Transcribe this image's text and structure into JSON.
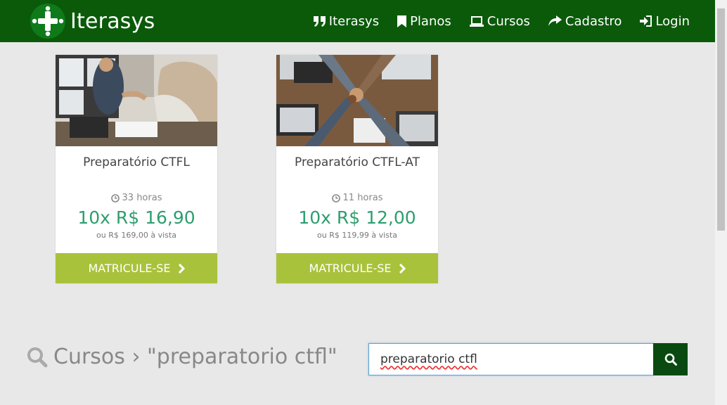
{
  "brand": {
    "name": "Iterasys"
  },
  "nav": [
    {
      "label": "Iterasys",
      "icon": "quote-icon"
    },
    {
      "label": "Planos",
      "icon": "bookmark-icon"
    },
    {
      "label": "Cursos",
      "icon": "laptop-icon"
    },
    {
      "label": "Cadastro",
      "icon": "share-icon"
    },
    {
      "label": "Login",
      "icon": "sign-in-icon"
    }
  ],
  "cards": [
    {
      "title": "Preparatório CTFL",
      "hours": "33 horas",
      "price": "10x R$ 16,90",
      "cash": "ou R$ 169,00 à vista",
      "button": "MATRICULE-SE"
    },
    {
      "title": "Preparatório CTFL-AT",
      "hours": "11 horas",
      "price": "10x R$ 12,00",
      "cash": "ou R$ 119,99 à vista",
      "button": "MATRICULE-SE"
    }
  ],
  "search": {
    "heading": "Cursos › \"preparatorio ctfl\"",
    "query": "preparatorio ctfl"
  },
  "colors": {
    "navbar": "#0a5a0a",
    "button": "#a9c23c",
    "price": "#2e9e6e",
    "search_button": "#0a4a10"
  }
}
